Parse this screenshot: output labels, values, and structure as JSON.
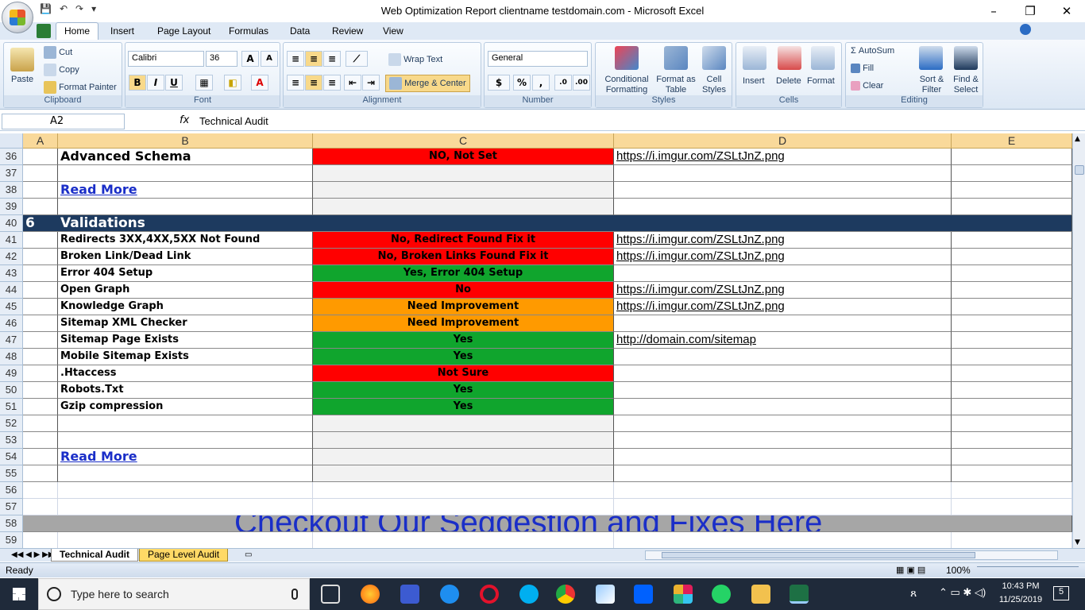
{
  "window": {
    "title": "Web Optimization Report clientname testdomain.com - Microsoft Excel",
    "controls": [
      "–",
      "❐",
      "✕"
    ]
  },
  "quick_access": [
    "💾",
    "↶",
    "↷",
    "▾"
  ],
  "tabs": [
    "Home",
    "Insert",
    "Page Layout",
    "Formulas",
    "Data",
    "Review",
    "View"
  ],
  "ribbon": {
    "clipboard": {
      "paste": "Paste",
      "cut": "Cut",
      "copy": "Copy",
      "format_painter": "Format Painter",
      "label": "Clipboard"
    },
    "font": {
      "name": "Calibri",
      "size": "36",
      "label": "Font",
      "bold": "B",
      "italic": "I",
      "underline": "U"
    },
    "alignment": {
      "wrap": "Wrap Text",
      "merge": "Merge & Center",
      "label": "Alignment"
    },
    "number": {
      "format": "General",
      "currency": "$",
      "percent": "%",
      "comma": ",",
      "label": "Number"
    },
    "styles": {
      "conditional": "Conditional Formatting",
      "table": "Format as Table",
      "cell": "Cell Styles",
      "label": "Styles"
    },
    "cells": {
      "insert": "Insert",
      "delete": "Delete",
      "format": "Format",
      "label": "Cells"
    },
    "editing": {
      "autosum": "AutoSum",
      "fill": "Fill",
      "clear": "Clear",
      "sort": "Sort & Filter",
      "find": "Find & Select",
      "label": "Editing"
    }
  },
  "formula_bar": {
    "name_box": "A2",
    "fx": "fx",
    "value": "Technical Audit"
  },
  "columns": [
    "A",
    "B",
    "C",
    "D",
    "E"
  ],
  "rows": [
    {
      "n": "36",
      "a": "",
      "b": "Advanced Schema",
      "c": "NO, Not Set",
      "c_color": "red",
      "d": "https://i.imgur.com/ZSLtJnZ.png",
      "b_style": "big"
    },
    {
      "n": "37",
      "a": "",
      "b": "",
      "c": "",
      "c_color": "grey",
      "d": ""
    },
    {
      "n": "38",
      "a": "",
      "b": "Read More",
      "c": "",
      "c_color": "grey",
      "d": "",
      "b_style": "readmore"
    },
    {
      "n": "39",
      "a": "",
      "b": "",
      "c": "",
      "c_color": "grey",
      "d": ""
    },
    {
      "n": "40",
      "a": "6",
      "b": "Validations",
      "c": "",
      "c_color": "header",
      "d": "",
      "b_style": "section"
    },
    {
      "n": "41",
      "a": "",
      "b": "Redirects 3XX,4XX,5XX Not Found",
      "c": "No, Redirect Found Fix it",
      "c_color": "red",
      "d": "https://i.imgur.com/ZSLtJnZ.png"
    },
    {
      "n": "42",
      "a": "",
      "b": "Broken Link/Dead Link",
      "c": "No, Broken Links Found Fix it",
      "c_color": "red",
      "d": "https://i.imgur.com/ZSLtJnZ.png"
    },
    {
      "n": "43",
      "a": "",
      "b": "Error 404 Setup",
      "c": "Yes, Error 404 Setup",
      "c_color": "green",
      "d": ""
    },
    {
      "n": "44",
      "a": "",
      "b": "Open Graph",
      "c": "No",
      "c_color": "red",
      "d": "https://i.imgur.com/ZSLtJnZ.png"
    },
    {
      "n": "45",
      "a": "",
      "b": "Knowledge Graph",
      "c": "Need Improvement",
      "c_color": "orange",
      "d": "https://i.imgur.com/ZSLtJnZ.png"
    },
    {
      "n": "46",
      "a": "",
      "b": "Sitemap XML Checker",
      "c": "Need Improvement",
      "c_color": "orange",
      "d": ""
    },
    {
      "n": "47",
      "a": "",
      "b": "Sitemap Page Exists",
      "c": "Yes",
      "c_color": "green",
      "d": "http://domain.com/sitemap"
    },
    {
      "n": "48",
      "a": "",
      "b": "Mobile Sitemap Exists",
      "c": "Yes",
      "c_color": "green",
      "d": ""
    },
    {
      "n": "49",
      "a": "",
      "b": ".Htaccess",
      "c": "Not Sure",
      "c_color": "red",
      "d": ""
    },
    {
      "n": "50",
      "a": "",
      "b": "Robots.Txt",
      "c": "Yes",
      "c_color": "green",
      "d": ""
    },
    {
      "n": "51",
      "a": "",
      "b": "Gzip compression",
      "c": "Yes",
      "c_color": "green",
      "d": ""
    },
    {
      "n": "52",
      "a": "",
      "b": "",
      "c": "",
      "c_color": "grey",
      "d": ""
    },
    {
      "n": "53",
      "a": "",
      "b": "",
      "c": "",
      "c_color": "grey",
      "d": ""
    },
    {
      "n": "54",
      "a": "",
      "b": "Read More",
      "c": "",
      "c_color": "grey",
      "d": "",
      "b_style": "readmore"
    },
    {
      "n": "55",
      "a": "",
      "b": "",
      "c": "",
      "c_color": "grey",
      "d": ""
    },
    {
      "n": "56",
      "a": "",
      "b": "",
      "c": "",
      "c_color": "blank",
      "d": ""
    },
    {
      "n": "57",
      "a": "",
      "b": "",
      "c": "",
      "c_color": "blank",
      "d": ""
    },
    {
      "n": "58",
      "a": "",
      "b": "Checkout Our Seggestion and Fixes Here",
      "c": "",
      "c_color": "banner",
      "d": "",
      "b_style": "banner"
    },
    {
      "n": "59",
      "a": "",
      "b": "",
      "c": "",
      "c_color": "blank",
      "d": ""
    }
  ],
  "sheet_tabs": [
    "Technical Audit",
    "Page Level Audit"
  ],
  "status": {
    "ready": "Ready",
    "zoom": "100%"
  },
  "taskbar": {
    "search_placeholder": "Type here to search",
    "time": "10:43 PM",
    "date": "11/25/2019",
    "notifications": "5"
  },
  "colors": {
    "red": "#ff0000",
    "green": "#10a52d",
    "orange": "#ff9a00",
    "section": "#1d3a5f",
    "banner": "#a6a6a6",
    "link_blue": "#1a2ec8"
  }
}
